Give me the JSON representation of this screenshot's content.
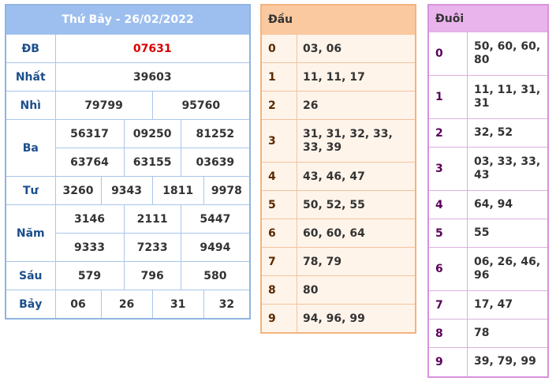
{
  "results": {
    "title": "Thứ Bảy - 26/02/2022",
    "rows": {
      "db": {
        "label": "ĐB",
        "values": [
          "07631"
        ]
      },
      "nhat": {
        "label": "Nhất",
        "values": [
          "39603"
        ]
      },
      "nhi": {
        "label": "Nhì",
        "values": [
          "79799",
          "95760"
        ]
      },
      "ba": {
        "label": "Ba",
        "values": [
          "56317",
          "09250",
          "81252",
          "63764",
          "63155",
          "03639"
        ]
      },
      "tu": {
        "label": "Tư",
        "values": [
          "3260",
          "9343",
          "1811",
          "9978"
        ]
      },
      "nam": {
        "label": "Năm",
        "values": [
          "3146",
          "2111",
          "5447",
          "9333",
          "7233",
          "9494"
        ]
      },
      "sau": {
        "label": "Sáu",
        "values": [
          "579",
          "796",
          "580"
        ]
      },
      "bay": {
        "label": "Bảy",
        "values": [
          "06",
          "26",
          "31",
          "32"
        ]
      }
    }
  },
  "dau": {
    "header": "Đầu",
    "rows": [
      {
        "k": "0",
        "v": "03, 06"
      },
      {
        "k": "1",
        "v": "11, 11, 17"
      },
      {
        "k": "2",
        "v": "26"
      },
      {
        "k": "3",
        "v": "31, 31, 32, 33, 33, 39"
      },
      {
        "k": "4",
        "v": "43, 46, 47"
      },
      {
        "k": "5",
        "v": "50, 52, 55"
      },
      {
        "k": "6",
        "v": "60, 60, 64"
      },
      {
        "k": "7",
        "v": "78, 79"
      },
      {
        "k": "8",
        "v": "80"
      },
      {
        "k": "9",
        "v": "94, 96, 99"
      }
    ]
  },
  "duoi": {
    "header": "Đuôi",
    "rows": [
      {
        "k": "0",
        "v": "50, 60, 60, 80"
      },
      {
        "k": "1",
        "v": "11, 11, 31, 31"
      },
      {
        "k": "2",
        "v": "32, 52"
      },
      {
        "k": "3",
        "v": "03, 33, 33, 43"
      },
      {
        "k": "4",
        "v": "64, 94"
      },
      {
        "k": "5",
        "v": "55"
      },
      {
        "k": "6",
        "v": "06, 26, 46, 96"
      },
      {
        "k": "7",
        "v": "17, 47"
      },
      {
        "k": "8",
        "v": "78"
      },
      {
        "k": "9",
        "v": "39, 79, 99"
      }
    ]
  },
  "colors": {
    "results_header": "#9dbff0",
    "results_label": "#1c4f8c",
    "special_prize": "#d90000",
    "dau_header": "#fbc99f",
    "duoi_header": "#e9b3ec"
  }
}
